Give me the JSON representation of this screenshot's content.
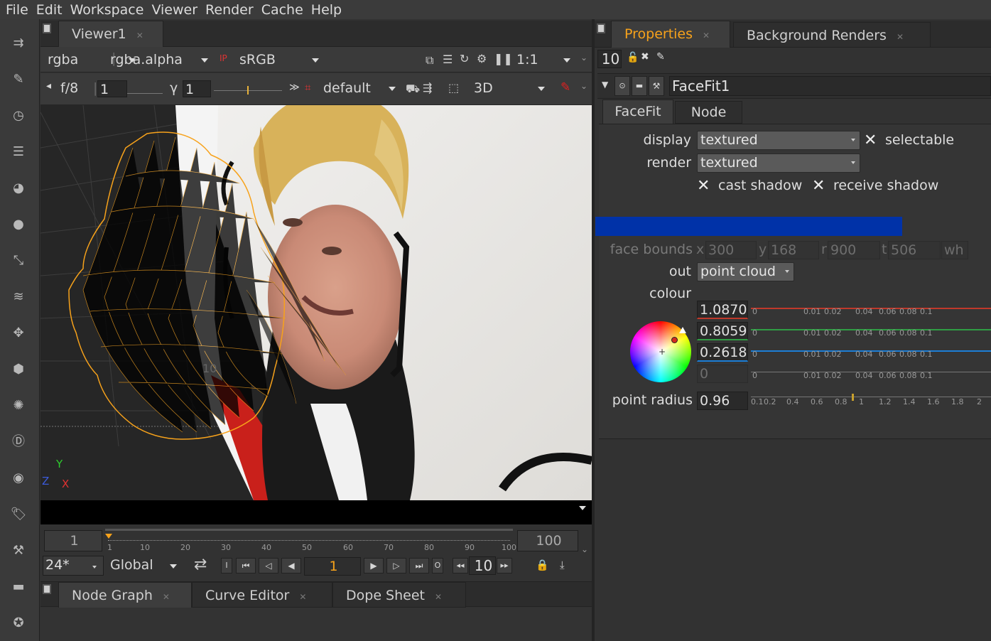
{
  "menu": [
    "File",
    "Edit",
    "Workspace",
    "Viewer",
    "Render",
    "Cache",
    "Help"
  ],
  "viewer": {
    "tab": "Viewer1",
    "row1": {
      "channels": "rgba",
      "alpha": "rgba.alpha",
      "colorspace": "sRGB",
      "zoom": "1:1"
    },
    "row2": {
      "fstop": "f/8",
      "gain": "1",
      "gamma_label": "γ",
      "gamma": "1",
      "lut": "default",
      "mode": "3D"
    },
    "axis": {
      "y": "Y",
      "z": "Z",
      "x": "X"
    },
    "grid_label": "10",
    "timeline": {
      "start": "1",
      "end": "100",
      "current": "1",
      "ticks": [
        "1",
        "10",
        "20",
        "30",
        "40",
        "50",
        "60",
        "70",
        "80",
        "90",
        "100"
      ]
    },
    "playback": {
      "fps": "24*",
      "scope": "Global",
      "frame": "1",
      "step": "10"
    }
  },
  "bottom_tabs": [
    "Node Graph",
    "Curve Editor",
    "Dope Sheet"
  ],
  "properties": {
    "tabs": [
      "Properties",
      "Background Renders"
    ],
    "max_panels": "10",
    "node_name": "FaceFit1",
    "subtabs": [
      "FaceFit",
      "Node"
    ],
    "display_label": "display",
    "display_value": "textured",
    "selectable_label": "selectable",
    "render_label": "render",
    "render_value": "textured",
    "cast_shadow": "cast shadow",
    "receive_shadow": "receive shadow",
    "face_bounds_label": "face bounds",
    "face_bounds": {
      "x_label": "x",
      "x": "300",
      "y_label": "y",
      "y": "168",
      "r_label": "r",
      "r": "900",
      "t_label": "t",
      "t": "506",
      "wh": "wh"
    },
    "out_label": "out",
    "out_value": "point cloud",
    "colour_label": "colour",
    "colour": {
      "r": "1.0870",
      "g": "0.8059",
      "b": "0.2618",
      "a": "0"
    },
    "colour_ticks": [
      "0",
      "0.01",
      "0.02",
      "0.04",
      "0.06",
      "0.08",
      "0.1"
    ],
    "point_radius_label": "point radius",
    "point_radius": "0.96",
    "radius_ticks": [
      "0.1",
      "0.2",
      "0.4",
      "0.6",
      "0.8",
      "1",
      "1.2",
      "1.4",
      "1.6",
      "1.8",
      "2"
    ]
  },
  "colors": {
    "accent": "#f7a21b",
    "progress": "#0032a8",
    "bg": "#323232"
  }
}
